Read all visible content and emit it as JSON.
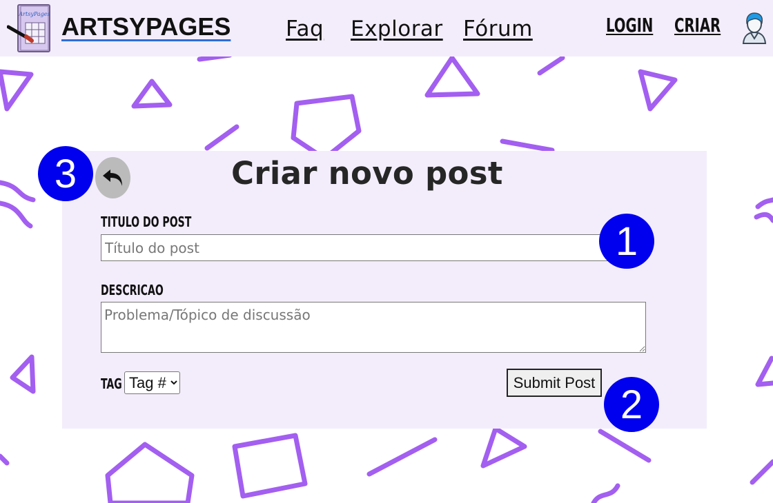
{
  "header": {
    "logo_text": "ArtsyPages",
    "brand": "ARTSYPAGES",
    "nav": [
      "Faq",
      "Explorar",
      "Fórum"
    ],
    "login_label": "LOGIN",
    "create_label": "CRIAR"
  },
  "form": {
    "title": "Criar novo post",
    "post_title_label": "TITULO DO POST",
    "post_title_placeholder": "Título do post",
    "post_title_value": "",
    "description_label": "DESCRICAO",
    "description_placeholder": "Problema/Tópico de discussão",
    "description_value": "",
    "tag_label": "TAG",
    "tag_selected": "Tag #",
    "submit_label": "Submit Post"
  },
  "markers": [
    "1",
    "2",
    "3"
  ],
  "colors": {
    "header_bg": "#f3edfb",
    "card_bg": "#f3edfb",
    "doodle": "#a35ff0",
    "marker": "#0000ee",
    "back_button": "#bbbbbb"
  },
  "icons": {
    "back": "undo-arrow-icon",
    "avatar": "user-avatar-icon",
    "logo": "artsypages-logo-icon"
  }
}
